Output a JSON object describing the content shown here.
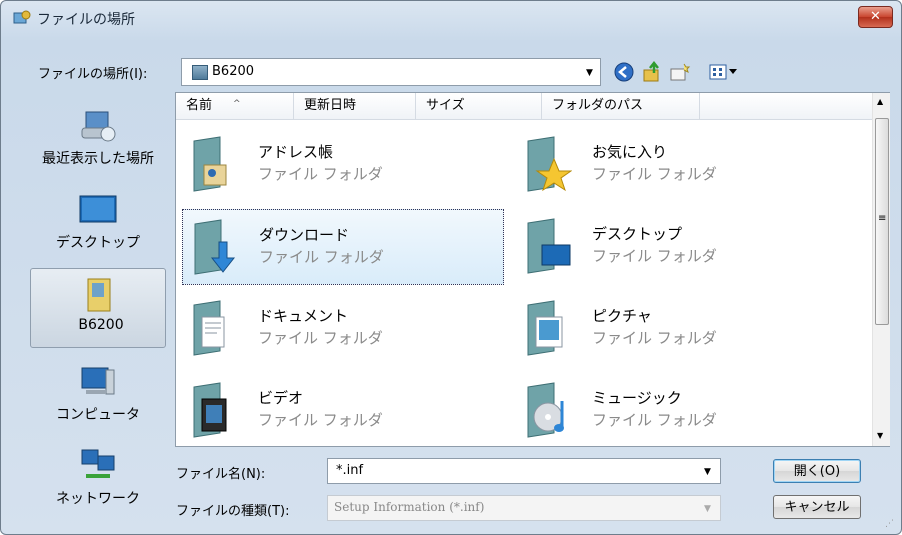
{
  "window": {
    "title": "ファイルの場所",
    "close_label": "✕"
  },
  "lookin": {
    "label": "ファイルの場所(I):",
    "value": "B6200"
  },
  "places": [
    {
      "label": "最近表示した場所",
      "icon": "recent-places-icon"
    },
    {
      "label": "デスクトップ",
      "icon": "desktop-icon"
    },
    {
      "label": "B6200",
      "icon": "user-folder-icon",
      "selected": true
    },
    {
      "label": "コンピュータ",
      "icon": "computer-icon"
    },
    {
      "label": "ネットワーク",
      "icon": "network-icon"
    }
  ],
  "columns": [
    "名前",
    "更新日時",
    "サイズ",
    "フォルダのパス"
  ],
  "items": [
    {
      "name": "アドレス帳",
      "type": "ファイル フォルダ",
      "icon": "contacts-folder-icon"
    },
    {
      "name": "お気に入り",
      "type": "ファイル フォルダ",
      "icon": "favorites-folder-icon"
    },
    {
      "name": "ダウンロード",
      "type": "ファイル フォルダ",
      "icon": "downloads-folder-icon",
      "selected": true
    },
    {
      "name": "デスクトップ",
      "type": "ファイル フォルダ",
      "icon": "desktop-folder-icon"
    },
    {
      "name": "ドキュメント",
      "type": "ファイル フォルダ",
      "icon": "documents-folder-icon"
    },
    {
      "name": "ピクチャ",
      "type": "ファイル フォルダ",
      "icon": "pictures-folder-icon"
    },
    {
      "name": "ビデオ",
      "type": "ファイル フォルダ",
      "icon": "videos-folder-icon"
    },
    {
      "name": "ミュージック",
      "type": "ファイル フォルダ",
      "icon": "music-folder-icon"
    }
  ],
  "filename": {
    "label": "ファイル名(N):",
    "value": "*.inf"
  },
  "filetype": {
    "label": "ファイルの種類(T):",
    "value": "Setup Information (*.inf)"
  },
  "buttons": {
    "open": "開く(O)",
    "cancel": "キャンセル"
  },
  "colors": {
    "accent": "#3c7fb1",
    "close": "#c9452f",
    "selection": "#d9ecfa"
  }
}
